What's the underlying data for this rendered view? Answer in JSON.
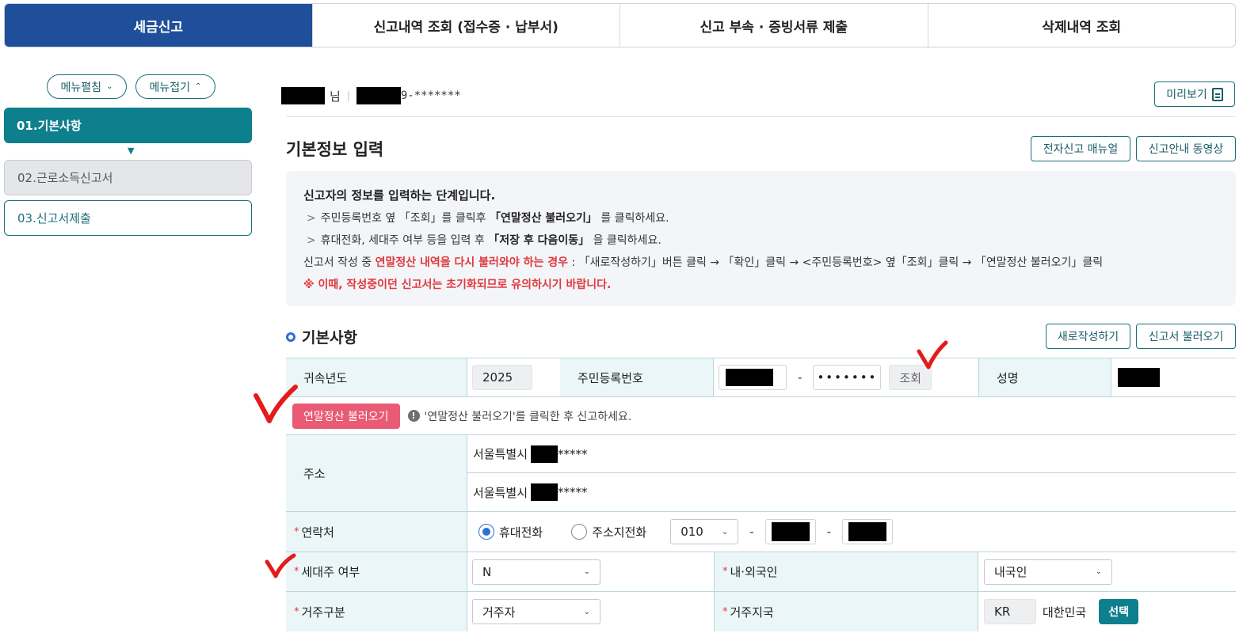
{
  "tabs": [
    {
      "label": "세금신고",
      "active": true
    },
    {
      "label": "신고내역 조회 (접수증 · 납부서)",
      "active": false
    },
    {
      "label": "신고 부속 · 증빙서류 제출",
      "active": false
    },
    {
      "label": "삭제내역 조회",
      "active": false
    }
  ],
  "sidebar": {
    "expand_label": "메뉴펼침",
    "collapse_label": "메뉴접기",
    "items": [
      {
        "label": "01.기본사항",
        "state": "active"
      },
      {
        "label": "02.근로소득신고서",
        "state": "disabled"
      },
      {
        "label": "03.신고서제출",
        "state": "normal"
      }
    ]
  },
  "user": {
    "name_suffix": "님",
    "rrn_suffix": "9-*******"
  },
  "preview_label": "미리보기",
  "page_title": "기본정보 입력",
  "manual_label": "전자신고 매뉴얼",
  "video_label": "신고안내 동영상",
  "info": {
    "heading": "신고자의 정보를 입력하는 단계입니다.",
    "step1_a": "주민등록번호 옆 「조회」를 클릭후 ",
    "step1_b": "「연말정산 불러오기」",
    "step1_c": " 를 클릭하세요.",
    "step2_a": "휴대전화, 세대주 여부 등을 입력 후 ",
    "step2_b": "「저장 후 다음이동」",
    "step2_c": " 을 클릭하세요.",
    "line3_a": "신고서 작성 중 ",
    "line3_red": "연말정산 내역을 다시 불러와야 하는 경우",
    "line3_b": " : 「새로작성하기」버튼 클릭 → 「확인」클릭 → <주민등록번호> 옆「조회」클릭 → 「연말정산 불러오기」클릭",
    "warning": "※ 이때, 작성중이던 신고서는 초기화되므로 유의하시기 바랍니다."
  },
  "section": {
    "title": "기본사항",
    "new_label": "새로작성하기",
    "load_label": "신고서 불러오기"
  },
  "form": {
    "year_label": "귀속년도",
    "year_value": "2025",
    "rrn_label": "주민등록번호",
    "rrn_masked": "•••••••",
    "lookup_label": "조회",
    "name_label": "성명",
    "import_button": "연말정산 불러오기",
    "import_hint": "'연말정산 불러오기'를 클릭한 후 신고하세요.",
    "address_label": "주소",
    "address1": "서울특별시",
    "address1_mask": "*****",
    "address2": "서울특별시",
    "address2_mask": "*****",
    "contact_label": "연락처",
    "mobile_label": "휴대전화",
    "home_label": "주소지전화",
    "phone_prefix": "010",
    "household_label": "세대주 여부",
    "household_value": "N",
    "nationality_label": "내·외국인",
    "nationality_value": "내국인",
    "residency_label": "거주구분",
    "residency_value": "거주자",
    "country_label": "거주지국",
    "country_code": "KR",
    "country_name": "대한민국",
    "select_label": "선택"
  },
  "colors": {
    "tab_active": "#1f4f9a",
    "teal": "#0e7f8c",
    "pink_button": "#e95a75",
    "alert_red": "#e0393e"
  }
}
